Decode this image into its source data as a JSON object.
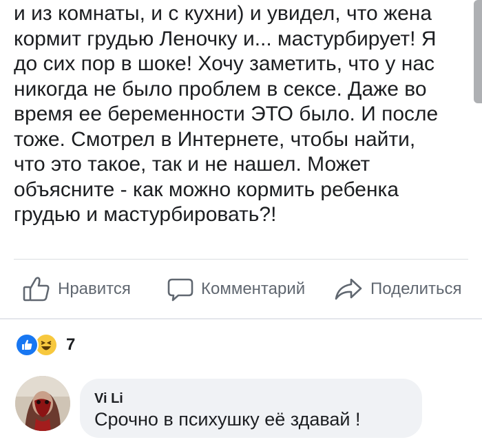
{
  "post": {
    "lines": [
      "и из комнаты, и с кухни) и увидел, что жена",
      "кормит грудью Леночку и... мастурбирует! Я",
      "до сих пор в шоке! Хочу заметить, что у нас",
      "никогда не было проблем в сексе. Даже во",
      "время ее беременности ЭТО было. И после",
      "тоже. Смотрел в Интернете, чтобы найти,",
      "что это такое, так и не нашел. Может",
      "объясните - как можно кормить ребенка",
      "грудью и мастурбировать?!"
    ]
  },
  "actions": {
    "like_label": "Нравится",
    "like_icon": "thumbs-up-icon",
    "comment_label": "Комментарий",
    "comment_icon": "speech-bubble-icon",
    "share_label": "Поделиться",
    "share_icon": "share-arrow-icon"
  },
  "reactions": {
    "icons": [
      "like-reaction-icon",
      "haha-reaction-icon"
    ],
    "count": "7"
  },
  "comment": {
    "author": "Vi Li",
    "text": "Срочно в психушку её здавай !"
  },
  "colors": {
    "text": "#1c1e21",
    "action_text": "#606770",
    "like_blue": "#1877f2",
    "haha_yellow": "#f7c83e",
    "bubble_bg": "#f0f2f5"
  }
}
